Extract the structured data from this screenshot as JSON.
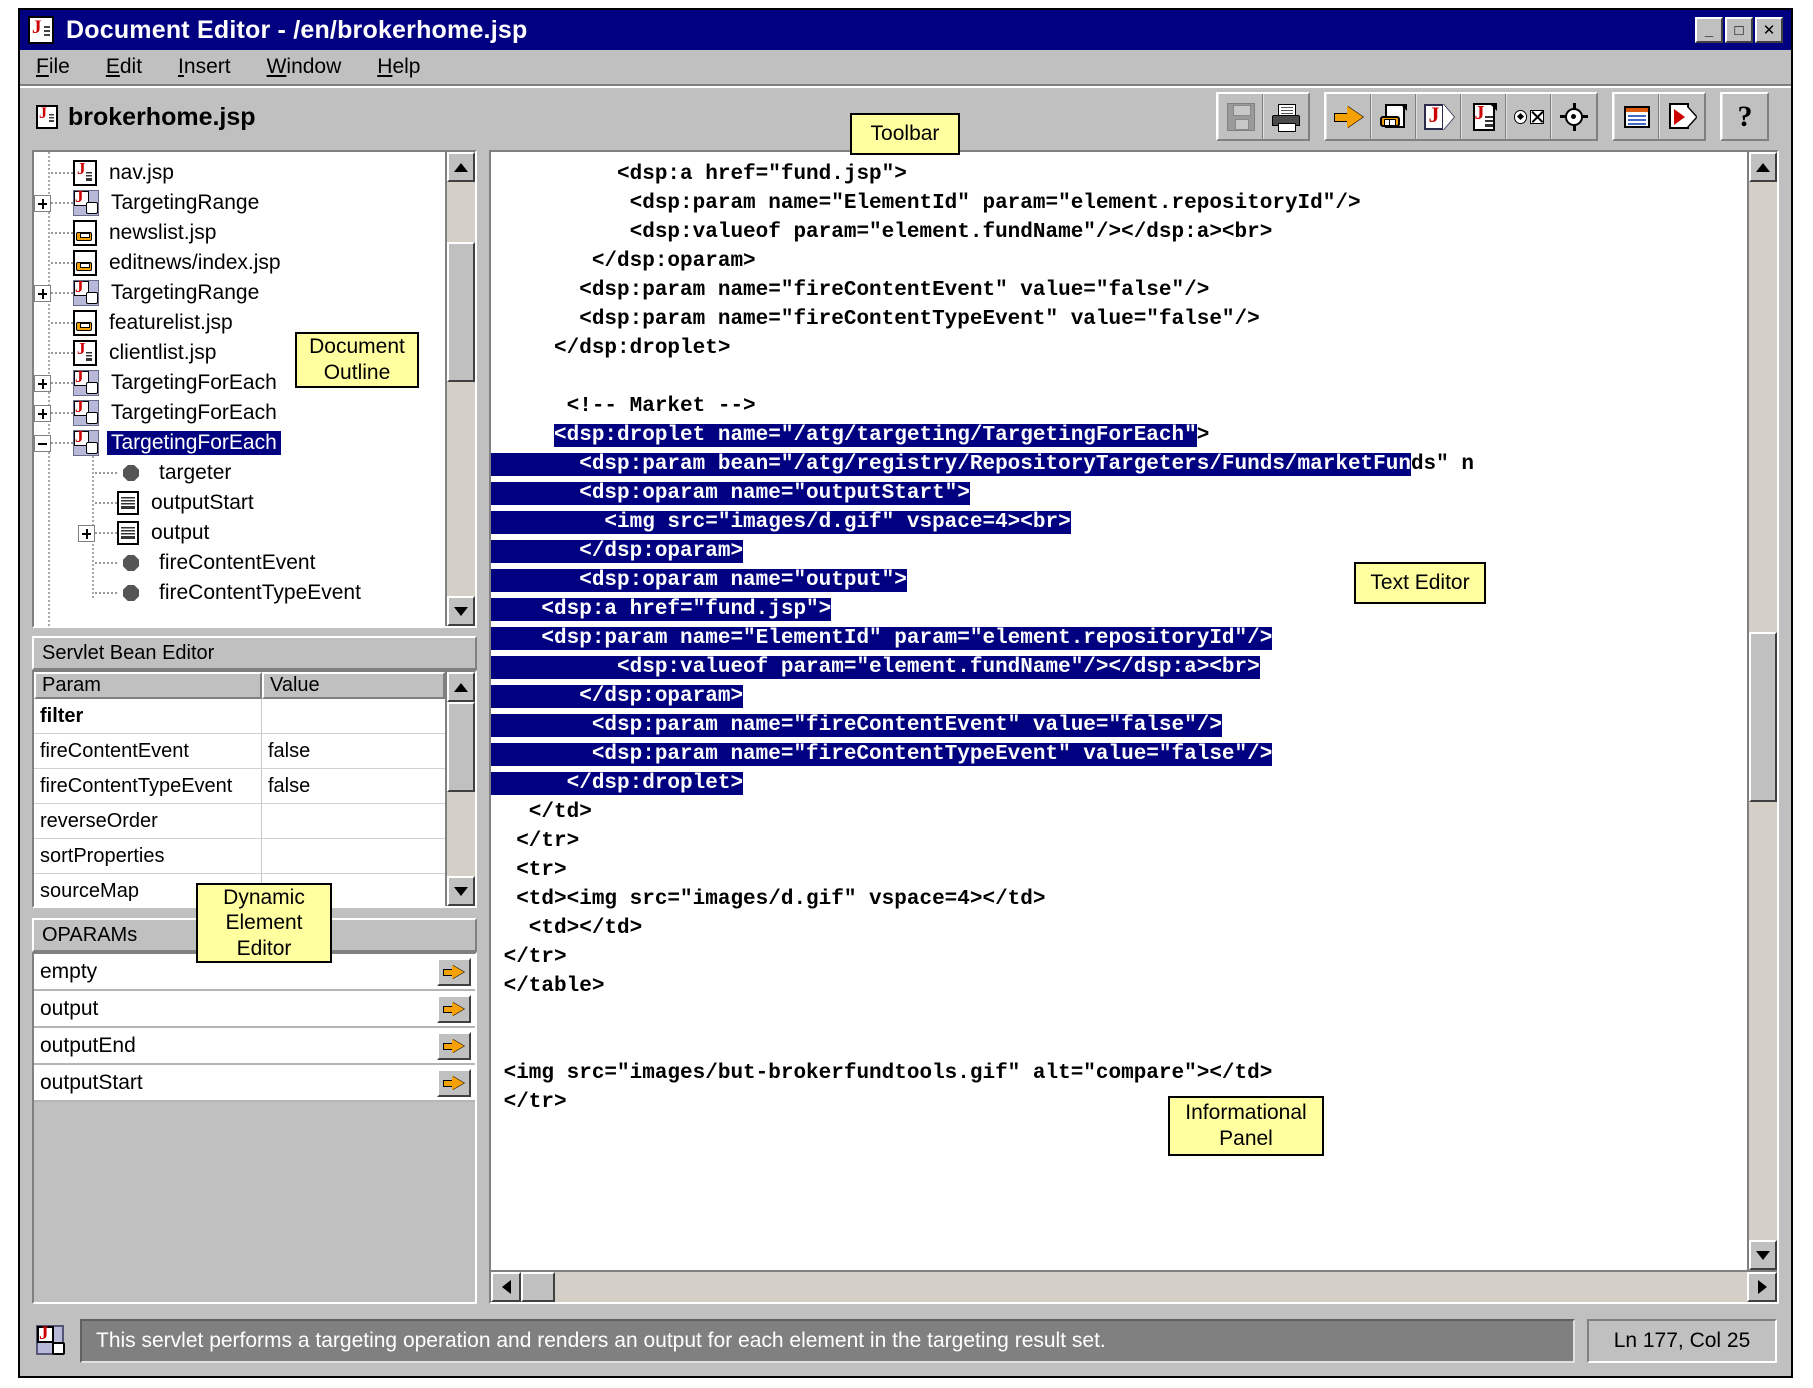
{
  "window": {
    "title": "Document Editor - /en/brokerhome.jsp",
    "title_icon": "jsp-document-icon",
    "controls": [
      {
        "name": "minimize-button",
        "glyph": "_"
      },
      {
        "name": "maximize-button",
        "glyph": "□"
      },
      {
        "name": "close-button",
        "glyph": "✕"
      }
    ]
  },
  "menubar": {
    "items": [
      {
        "name": "menu-file",
        "mnemonic": "F",
        "rest": "ile"
      },
      {
        "name": "menu-edit",
        "mnemonic": "E",
        "rest": "dit"
      },
      {
        "name": "menu-insert",
        "mnemonic": "I",
        "rest": "nsert"
      },
      {
        "name": "menu-window",
        "mnemonic": "W",
        "rest": "indow"
      },
      {
        "name": "menu-help",
        "mnemonic": "H",
        "rest": "elp"
      }
    ]
  },
  "document": {
    "name": "brokerhome.jsp",
    "icon": "jsp-document-icon"
  },
  "toolbar": {
    "groups": [
      {
        "buttons": [
          {
            "name": "save-button",
            "icon": "floppy-disk-icon",
            "enabled": false
          },
          {
            "name": "print-button",
            "icon": "printer-icon",
            "enabled": true
          }
        ]
      },
      {
        "buttons": [
          {
            "name": "insert-link-button",
            "icon": "orange-arrow-icon",
            "enabled": true
          },
          {
            "name": "insert-page-link-button",
            "icon": "page-chain-link-icon",
            "enabled": true
          },
          {
            "name": "insert-jsp-tag-button",
            "icon": "j-pennant-icon",
            "enabled": true
          },
          {
            "name": "insert-jsp-document-button",
            "icon": "j-document-icon",
            "enabled": true
          },
          {
            "name": "insert-parameter-button",
            "icon": "circle-square-icon",
            "enabled": true
          },
          {
            "name": "locate-target-button",
            "icon": "crosshair-target-icon",
            "enabled": true
          }
        ]
      },
      {
        "buttons": [
          {
            "name": "preview-window-button",
            "icon": "window-lines-icon",
            "enabled": true
          },
          {
            "name": "run-page-button",
            "icon": "page-play-icon",
            "enabled": true
          }
        ]
      },
      {
        "buttons": [
          {
            "name": "help-button",
            "icon": "question-mark-icon",
            "enabled": true
          }
        ]
      }
    ]
  },
  "outline": {
    "panel_name": "Document Outline",
    "items": [
      {
        "label": "nav.jsp",
        "icon": "jsp-document-icon",
        "indent": 0,
        "expander": "none",
        "selected": false
      },
      {
        "label": "TargetingRange",
        "icon": "servlet-bean-icon",
        "indent": 0,
        "expander": "plus",
        "selected": false
      },
      {
        "label": "newslist.jsp",
        "icon": "link-document-icon",
        "indent": 0,
        "expander": "none",
        "selected": false
      },
      {
        "label": "editnews/index.jsp",
        "icon": "link-document-icon",
        "indent": 0,
        "expander": "none",
        "selected": false
      },
      {
        "label": "TargetingRange",
        "icon": "servlet-bean-icon",
        "indent": 0,
        "expander": "plus",
        "selected": false
      },
      {
        "label": "featurelist.jsp",
        "icon": "link-document-icon",
        "indent": 0,
        "expander": "none",
        "selected": false
      },
      {
        "label": "clientlist.jsp",
        "icon": "jsp-document-icon",
        "indent": 0,
        "expander": "none",
        "selected": false
      },
      {
        "label": "TargetingForEach",
        "icon": "servlet-bean-icon",
        "indent": 0,
        "expander": "plus",
        "selected": false
      },
      {
        "label": "TargetingForEach",
        "icon": "servlet-bean-icon",
        "indent": 0,
        "expander": "plus",
        "selected": false
      },
      {
        "label": "TargetingForEach",
        "icon": "servlet-bean-icon",
        "indent": 0,
        "expander": "minus",
        "selected": true
      },
      {
        "label": "targeter",
        "icon": "param-bullet-icon",
        "indent": 1,
        "expander": "none",
        "selected": false
      },
      {
        "label": "outputStart",
        "icon": "oparam-scroll-icon",
        "indent": 1,
        "expander": "none",
        "selected": false
      },
      {
        "label": "output",
        "icon": "oparam-scroll-icon",
        "indent": 1,
        "expander": "plus",
        "selected": false
      },
      {
        "label": "fireContentEvent",
        "icon": "param-bullet-icon",
        "indent": 1,
        "expander": "none",
        "selected": false
      },
      {
        "label": "fireContentTypeEvent",
        "icon": "param-bullet-icon",
        "indent": 1,
        "expander": "none",
        "selected": false
      }
    ]
  },
  "servlet_bean_editor": {
    "title": "Servlet Bean Editor",
    "columns": [
      "Param",
      "Value"
    ],
    "rows": [
      {
        "param": "filter",
        "value": "",
        "bold": true
      },
      {
        "param": "fireContentEvent",
        "value": "false",
        "bold": false
      },
      {
        "param": "fireContentTypeEvent",
        "value": "false",
        "bold": false
      },
      {
        "param": "reverseOrder",
        "value": "",
        "bold": false
      },
      {
        "param": "sortProperties",
        "value": "",
        "bold": false
      },
      {
        "param": "sourceMap",
        "value": "",
        "bold": false
      }
    ]
  },
  "oparams": {
    "title": "OPARAMs",
    "rows": [
      {
        "label": "empty",
        "goto_icon": "orange-arrow-icon"
      },
      {
        "label": "output",
        "goto_icon": "orange-arrow-icon"
      },
      {
        "label": "outputEnd",
        "goto_icon": "orange-arrow-icon"
      },
      {
        "label": "outputStart",
        "goto_icon": "orange-arrow-icon"
      }
    ]
  },
  "editor": {
    "selection_color": "#000080",
    "lines": [
      {
        "text": "          <dsp:a href=\"fund.jsp\">",
        "sel": null
      },
      {
        "text": "           <dsp:param name=\"ElementId\" param=\"element.repositoryId\"/>",
        "sel": null
      },
      {
        "text": "           <dsp:valueof param=\"element.fundName\"/></dsp:a><br>",
        "sel": null
      },
      {
        "text": "        </dsp:oparam>",
        "sel": null
      },
      {
        "text": "       <dsp:param name=\"fireContentEvent\" value=\"false\"/>",
        "sel": null
      },
      {
        "text": "       <dsp:param name=\"fireContentTypeEvent\" value=\"false\"/>",
        "sel": null
      },
      {
        "text": "     </dsp:droplet>",
        "sel": null
      },
      {
        "text": "",
        "sel": null
      },
      {
        "text": "      <!-- Market -->",
        "sel": null
      },
      {
        "text": "     <dsp:droplet name=\"/atg/targeting/TargetingForEach\">",
        "sel": [
          5,
          56
        ]
      },
      {
        "text": "       <dsp:param bean=\"/atg/registry/RepositoryTargeters/Funds/marketFunds\" n",
        "sel": [
          0,
          73
        ]
      },
      {
        "text": "       <dsp:oparam name=\"outputStart\">",
        "sel": [
          0,
          40
        ]
      },
      {
        "text": "         <img src=\"images/d.gif\" vspace=4><br>",
        "sel": [
          0,
          47
        ]
      },
      {
        "text": "       </dsp:oparam>",
        "sel": [
          0,
          27
        ]
      },
      {
        "text": "       <dsp:oparam name=\"output\">",
        "sel": [
          0,
          36
        ]
      },
      {
        "text": "    <dsp:a href=\"fund.jsp\">",
        "sel": [
          0,
          30
        ]
      },
      {
        "text": "    <dsp:param name=\"ElementId\" param=\"element.repositoryId\"/>",
        "sel": [
          0,
          65
        ]
      },
      {
        "text": "          <dsp:valueof param=\"element.fundName\"/></dsp:a><br>",
        "sel": [
          0,
          62
        ]
      },
      {
        "text": "       </dsp:oparam>",
        "sel": [
          0,
          27
        ]
      },
      {
        "text": "        <dsp:param name=\"fireContentEvent\" value=\"false\"/>",
        "sel": [
          0,
          61
        ]
      },
      {
        "text": "        <dsp:param name=\"fireContentTypeEvent\" value=\"false\"/>",
        "sel": [
          0,
          65
        ]
      },
      {
        "text": "      </dsp:droplet>",
        "sel": [
          0,
          24
        ]
      },
      {
        "text": "   </td>",
        "sel": null
      },
      {
        "text": "  </tr>",
        "sel": null
      },
      {
        "text": "  <tr>",
        "sel": null
      },
      {
        "text": "  <td><img src=\"images/d.gif\" vspace=4></td>",
        "sel": null
      },
      {
        "text": "   <td></td>",
        "sel": null
      },
      {
        "text": " </tr>",
        "sel": null
      },
      {
        "text": " </table>",
        "sel": null
      },
      {
        "text": "",
        "sel": null
      },
      {
        "text": "",
        "sel": null
      },
      {
        "text": " <img src=\"images/but-brokerfundtools.gif\" alt=\"compare\"></td>",
        "sel": null
      },
      {
        "text": " </tr>",
        "sel": null
      }
    ]
  },
  "statusbar": {
    "icon": "servlet-bean-icon",
    "message": "This servlet performs a targeting operation and renders an output for each element in the targeting result set.",
    "position": "Ln 177, Col 25"
  },
  "callouts": [
    {
      "id": "callout-toolbar",
      "name": "callout-toolbar",
      "lines": [
        "Toolbar"
      ]
    },
    {
      "id": "callout-outline",
      "name": "callout-document-outline",
      "lines": [
        "Document",
        "Outline"
      ]
    },
    {
      "id": "callout-texteditor",
      "name": "callout-text-editor",
      "lines": [
        "Text Editor"
      ]
    },
    {
      "id": "callout-dynamic",
      "name": "callout-dynamic-element-editor",
      "lines": [
        "Dynamic",
        "Element",
        "Editor"
      ]
    },
    {
      "id": "callout-info",
      "name": "callout-informational-panel",
      "lines": [
        "Informational",
        "Panel"
      ]
    }
  ]
}
